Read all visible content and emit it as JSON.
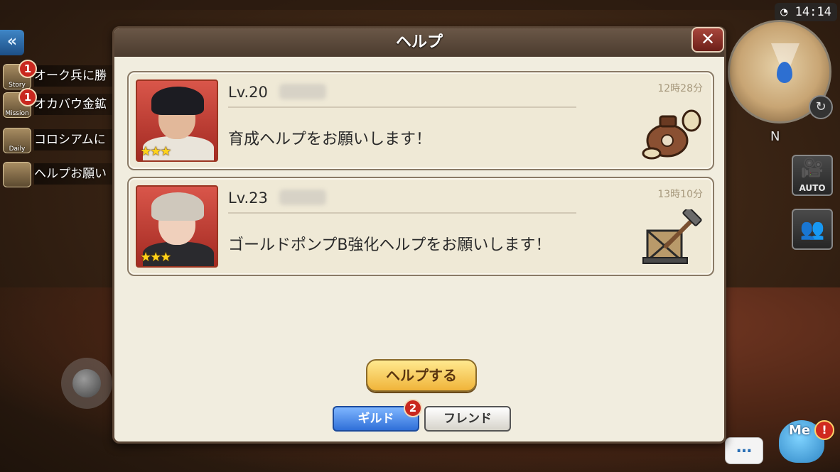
{
  "hud": {
    "clock": "14:14",
    "compass": "N",
    "auto_label": "AUTO",
    "me_label": "Me",
    "alert_mark": "!",
    "chat_label": "…"
  },
  "quests": [
    {
      "icon_label": "Story",
      "text": "オーク兵に勝",
      "badge": "1"
    },
    {
      "icon_label": "Mission",
      "text": "オカバウ金鉱",
      "badge": "1"
    },
    {
      "icon_label": "Daily",
      "text": "コロシアムに",
      "badge": ""
    },
    {
      "icon_label": "",
      "text": "ヘルプお願い",
      "badge": ""
    }
  ],
  "dialog": {
    "title": "ヘルプ",
    "close_label": "✕",
    "requests": [
      {
        "level": "Lv.20",
        "time": "12時28分",
        "message": "育成ヘルプをお願いします！",
        "rarity": "★★★",
        "icon": "pot-icon"
      },
      {
        "level": "Lv.23",
        "time": "13時10分",
        "message": "ゴールドポンプB強化ヘルプをお願いします！",
        "rarity": "★★★",
        "icon": "crate-hammer-icon"
      }
    ],
    "help_button": "ヘルプする",
    "tabs": [
      {
        "label": "ギルド",
        "active": true,
        "badge": "2"
      },
      {
        "label": "フレンド",
        "active": false
      }
    ]
  },
  "colors": {
    "dialog_bg": "#f1eddf",
    "header": "#5a4838",
    "primary": "#f0b43a",
    "tab_active": "#2f6fd8",
    "badge": "#c9281f"
  }
}
